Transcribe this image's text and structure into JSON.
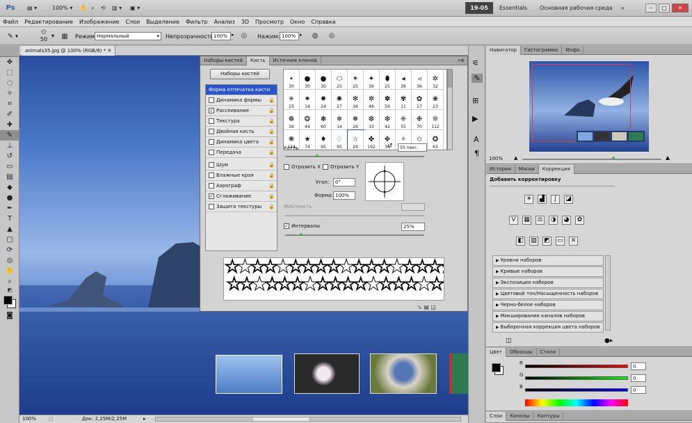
{
  "app": {
    "logo": "Ps",
    "zoom": "100%",
    "clock": "19-05",
    "workspaces": [
      "Essentials",
      "Основная рабочая среда"
    ],
    "window_buttons": [
      "–",
      "□",
      "✕"
    ]
  },
  "menu": [
    "Файл",
    "Редактирование",
    "Изображение",
    "Слои",
    "Выделение",
    "Фильтр",
    "Анализ",
    "3D",
    "Просмотр",
    "Окно",
    "Справка"
  ],
  "options": {
    "brush_size": "50",
    "mode_label": "Режим:",
    "mode_value": "Нормальный",
    "opacity_label": "Непрозрачность:",
    "opacity_value": "100%",
    "flow_label": "Нажим:",
    "flow_value": "100%"
  },
  "document": {
    "tab": "animals35.jpg @ 100% (RGB/8) *",
    "zoom": "100%",
    "doc_info": "Док: 2,25М/2,25М"
  },
  "brush_panel": {
    "tabs": [
      "Наборы кистей",
      "Кисть",
      "Источник клонов"
    ],
    "presets_button": "Наборы кистей",
    "settings": [
      {
        "label": "Форма отпечатка кисти",
        "checked": null,
        "selected": true,
        "lock": false
      },
      {
        "label": "Динамика формы",
        "checked": false,
        "lock": true
      },
      {
        "label": "Рассеивание",
        "checked": true,
        "lock": true
      },
      {
        "label": "Текстура",
        "checked": false,
        "lock": true
      },
      {
        "label": "Двойная кисть",
        "checked": false,
        "lock": true
      },
      {
        "label": "Динамика цвета",
        "checked": false,
        "lock": true
      },
      {
        "label": "Передача",
        "checked": false,
        "lock": true
      },
      {
        "label": "Шум",
        "checked": false,
        "lock": true
      },
      {
        "label": "Влажные края",
        "checked": false,
        "lock": true
      },
      {
        "label": "Аэрограф",
        "checked": false,
        "lock": true
      },
      {
        "label": "Сглаживание",
        "checked": true,
        "lock": true
      },
      {
        "label": "Защита текстуры",
        "checked": false,
        "lock": true
      }
    ],
    "brush_tips": [
      {
        "shape": "•",
        "size": "30"
      },
      {
        "shape": "●",
        "size": "30"
      },
      {
        "shape": "●",
        "size": "30"
      },
      {
        "shape": "⬭",
        "size": "25"
      },
      {
        "shape": "✶",
        "size": "25"
      },
      {
        "shape": "✦",
        "size": "36"
      },
      {
        "shape": "⬮",
        "size": "25"
      },
      {
        "shape": "◂",
        "size": "36"
      },
      {
        "shape": "◃",
        "size": "36"
      },
      {
        "shape": "✲",
        "size": "32"
      },
      {
        "shape": "✳",
        "size": "25"
      },
      {
        "shape": "✷",
        "size": "14"
      },
      {
        "shape": "✹",
        "size": "24"
      },
      {
        "shape": "✺",
        "size": "27"
      },
      {
        "shape": "✻",
        "size": "39"
      },
      {
        "shape": "✼",
        "size": "46"
      },
      {
        "shape": "✽",
        "size": "59"
      },
      {
        "shape": "✾",
        "size": "11"
      },
      {
        "shape": "✿",
        "size": "17"
      },
      {
        "shape": "❀",
        "size": "23"
      },
      {
        "shape": "❁",
        "size": "36"
      },
      {
        "shape": "❂",
        "size": "44"
      },
      {
        "shape": "❃",
        "size": "60"
      },
      {
        "shape": "❄",
        "size": "14"
      },
      {
        "shape": "❅",
        "size": "26"
      },
      {
        "shape": "❆",
        "size": "33"
      },
      {
        "shape": "❇",
        "size": "42"
      },
      {
        "shape": "❈",
        "size": "55"
      },
      {
        "shape": "❉",
        "size": "70"
      },
      {
        "shape": "❊",
        "size": "112"
      },
      {
        "shape": "❋",
        "size": "134"
      },
      {
        "shape": "★",
        "size": "74"
      },
      {
        "shape": "♦",
        "size": "95"
      },
      {
        "shape": "♢",
        "size": "95"
      },
      {
        "shape": "☆",
        "size": "29"
      },
      {
        "shape": "✤",
        "size": "192"
      },
      {
        "shape": "✥",
        "size": "36"
      },
      {
        "shape": "✧",
        "size": "36"
      },
      {
        "shape": "✩",
        "size": "33"
      },
      {
        "shape": "✪",
        "size": "63"
      }
    ],
    "size_label": "Кегль",
    "size_value": "50 пикс.",
    "flip_x": "Отразить X",
    "flip_y": "Отразить Y",
    "angle_label": "Угол:",
    "angle_value": "0°",
    "roundness_label": "Форма:",
    "roundness_value": "100%",
    "hardness_label": "Жесткость",
    "spacing_label": "Интервалы",
    "spacing_value": "25%"
  },
  "navigator": {
    "tabs": [
      "Навигатор",
      "Гистограмма",
      "Инфо"
    ],
    "zoom": "100%"
  },
  "adjustments": {
    "tabs": [
      "История",
      "Маски",
      "Коррекция"
    ],
    "title": "Добавить корректировку",
    "presets": [
      "Уровни наборов",
      "Кривые наборов",
      "Экспозиция наборов",
      "Цветовой тон/Насыщенность наборов",
      "Черно-белое наборов",
      "Микширование каналов наборов",
      "Выборочная коррекция цвета наборов"
    ]
  },
  "color": {
    "tabs": [
      "Цвет",
      "Образцы",
      "Стили"
    ],
    "channels": [
      {
        "label": "R",
        "value": "0"
      },
      {
        "label": "G",
        "value": "0"
      },
      {
        "label": "B",
        "value": "0"
      }
    ]
  },
  "layers": {
    "tabs": [
      "Слои",
      "Каналы",
      "Контуры"
    ]
  },
  "colors": {
    "canvas_top": "#294e9f",
    "canvas_mid": "#9ab8e8",
    "selection": "#2a54c8"
  }
}
